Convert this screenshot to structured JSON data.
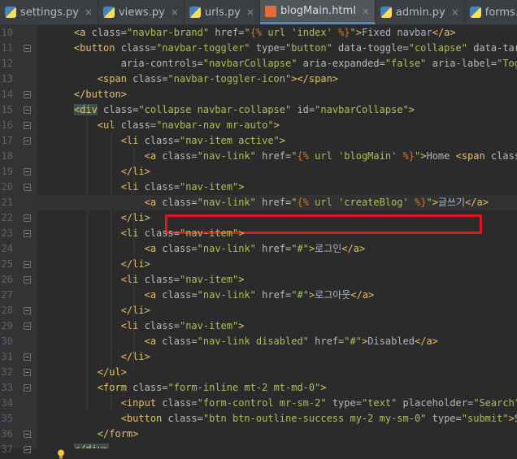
{
  "tabs": [
    {
      "label": "settings.py",
      "kind": "py",
      "active": false
    },
    {
      "label": "views.py",
      "kind": "py",
      "active": false
    },
    {
      "label": "urls.py",
      "kind": "py",
      "active": false
    },
    {
      "label": "blogMain.html",
      "kind": "html",
      "active": true
    },
    {
      "label": "admin.py",
      "kind": "py",
      "active": false
    },
    {
      "label": "forms.py",
      "kind": "py",
      "active": false
    }
  ],
  "close_glyph": "×",
  "lines": [
    {
      "n": "10",
      "segs": [
        [
          "t",
          "    "
        ],
        [
          "tag",
          "<a "
        ],
        [
          "attr",
          "class="
        ],
        [
          "str",
          "\"navbar-brand\""
        ],
        [
          "attr",
          " href="
        ],
        [
          "str",
          "\""
        ],
        [
          "dj",
          "{%"
        ],
        [
          "str",
          " url "
        ],
        [
          "str",
          "'index'"
        ],
        [
          "dj",
          " %}"
        ],
        [
          "str",
          "\""
        ],
        [
          "tag",
          ">"
        ],
        [
          "text",
          "Fixed navbar"
        ],
        [
          "tag",
          "</a>"
        ]
      ]
    },
    {
      "n": "11",
      "segs": [
        [
          "t",
          "    "
        ],
        [
          "tag",
          "<button "
        ],
        [
          "attr",
          "class="
        ],
        [
          "str",
          "\"navbar-toggler\""
        ],
        [
          "attr",
          " type="
        ],
        [
          "str",
          "\"button\""
        ],
        [
          "attr",
          " data-toggle="
        ],
        [
          "str",
          "\"collapse\""
        ],
        [
          "attr",
          " data-target="
        ],
        [
          "str",
          "\"#navbarColl"
        ]
      ]
    },
    {
      "n": "12",
      "segs": [
        [
          "t",
          "            "
        ],
        [
          "attr",
          "aria-controls="
        ],
        [
          "str",
          "\"navbarCollapse\""
        ],
        [
          "attr",
          " aria-expanded="
        ],
        [
          "str",
          "\"false\""
        ],
        [
          "attr",
          " aria-label="
        ],
        [
          "str",
          "\"Toggle navigation\""
        ],
        [
          "tag",
          ">"
        ]
      ]
    },
    {
      "n": "13",
      "segs": [
        [
          "t",
          "        "
        ],
        [
          "tag",
          "<span "
        ],
        [
          "attr",
          "class="
        ],
        [
          "str",
          "\"navbar-toggler-icon\""
        ],
        [
          "tag",
          "></span>"
        ]
      ]
    },
    {
      "n": "14",
      "segs": [
        [
          "t",
          "    "
        ],
        [
          "tag",
          "</button>"
        ]
      ]
    },
    {
      "n": "15",
      "segs": [
        [
          "t",
          "    "
        ],
        [
          "hltag",
          "<div"
        ],
        [
          "attr",
          " class="
        ],
        [
          "str",
          "\"collapse navbar-collapse\""
        ],
        [
          "attr",
          " id="
        ],
        [
          "str",
          "\"navbarCollapse\""
        ],
        [
          "tag",
          ">"
        ]
      ]
    },
    {
      "n": "16",
      "segs": [
        [
          "t",
          "        "
        ],
        [
          "tag",
          "<ul "
        ],
        [
          "attr",
          "class="
        ],
        [
          "str",
          "\"navbar-nav mr-auto\""
        ],
        [
          "tag",
          ">"
        ]
      ]
    },
    {
      "n": "17",
      "segs": [
        [
          "t",
          "            "
        ],
        [
          "tag",
          "<li "
        ],
        [
          "attr",
          "class="
        ],
        [
          "str",
          "\"nav-item active\""
        ],
        [
          "tag",
          ">"
        ]
      ]
    },
    {
      "n": "18",
      "segs": [
        [
          "t",
          "                "
        ],
        [
          "tag",
          "<a "
        ],
        [
          "attr",
          "class="
        ],
        [
          "str",
          "\"nav-link\""
        ],
        [
          "attr",
          " href="
        ],
        [
          "str",
          "\""
        ],
        [
          "dj",
          "{%"
        ],
        [
          "str",
          " url "
        ],
        [
          "str",
          "'blogMain'"
        ],
        [
          "dj",
          " %}"
        ],
        [
          "str",
          "\""
        ],
        [
          "tag",
          ">"
        ],
        [
          "text",
          "Home "
        ],
        [
          "tag",
          "<span "
        ],
        [
          "attr",
          "class="
        ],
        [
          "str",
          "\"sr-only\""
        ],
        [
          "tag",
          ">"
        ],
        [
          "text",
          "(curr"
        ]
      ]
    },
    {
      "n": "19",
      "segs": [
        [
          "t",
          "            "
        ],
        [
          "tag",
          "</li>"
        ]
      ]
    },
    {
      "n": "20",
      "segs": [
        [
          "t",
          "            "
        ],
        [
          "tag",
          "<li "
        ],
        [
          "attr",
          "class="
        ],
        [
          "str",
          "\"nav-item\""
        ],
        [
          "tag",
          ">"
        ]
      ]
    },
    {
      "n": "21",
      "segs": [
        [
          "t",
          "                "
        ],
        [
          "tag",
          "<a "
        ],
        [
          "attr",
          "class="
        ],
        [
          "str",
          "\"nav-link\""
        ],
        [
          "attr",
          " href="
        ],
        [
          "str",
          "\""
        ],
        [
          "dj",
          "{%"
        ],
        [
          "str",
          " url "
        ],
        [
          "str",
          "'createBlog'"
        ],
        [
          "dj",
          " %}"
        ],
        [
          "str",
          "\""
        ],
        [
          "tag",
          ">"
        ],
        [
          "text",
          "글쓰기"
        ],
        [
          "tag",
          "</a>"
        ]
      ],
      "cur": true
    },
    {
      "n": "22",
      "segs": [
        [
          "t",
          "            "
        ],
        [
          "tag",
          "</li>"
        ]
      ]
    },
    {
      "n": "23",
      "segs": [
        [
          "t",
          "            "
        ],
        [
          "tag",
          "<li "
        ],
        [
          "attr",
          "class="
        ],
        [
          "str",
          "\"nav-item\""
        ],
        [
          "tag",
          ">"
        ]
      ]
    },
    {
      "n": "24",
      "segs": [
        [
          "t",
          "                "
        ],
        [
          "tag",
          "<a "
        ],
        [
          "attr",
          "class="
        ],
        [
          "str",
          "\"nav-link\""
        ],
        [
          "attr",
          " href="
        ],
        [
          "str",
          "\"#\""
        ],
        [
          "tag",
          ">"
        ],
        [
          "text",
          "로그인"
        ],
        [
          "tag",
          "</a>"
        ]
      ]
    },
    {
      "n": "25",
      "segs": [
        [
          "t",
          "            "
        ],
        [
          "tag",
          "</li>"
        ]
      ]
    },
    {
      "n": "26",
      "segs": [
        [
          "t",
          "            "
        ],
        [
          "tag",
          "<li "
        ],
        [
          "attr",
          "class="
        ],
        [
          "str",
          "\"nav-item\""
        ],
        [
          "tag",
          ">"
        ]
      ]
    },
    {
      "n": "27",
      "segs": [
        [
          "t",
          "                "
        ],
        [
          "tag",
          "<a "
        ],
        [
          "attr",
          "class="
        ],
        [
          "str",
          "\"nav-link\""
        ],
        [
          "attr",
          " href="
        ],
        [
          "str",
          "\"#\""
        ],
        [
          "tag",
          ">"
        ],
        [
          "text",
          "로그아웃"
        ],
        [
          "tag",
          "</a>"
        ]
      ]
    },
    {
      "n": "28",
      "segs": [
        [
          "t",
          "            "
        ],
        [
          "tag",
          "</li>"
        ]
      ]
    },
    {
      "n": "29",
      "segs": [
        [
          "t",
          "            "
        ],
        [
          "tag",
          "<li "
        ],
        [
          "attr",
          "class="
        ],
        [
          "str",
          "\"nav-item\""
        ],
        [
          "tag",
          ">"
        ]
      ]
    },
    {
      "n": "30",
      "segs": [
        [
          "t",
          "                "
        ],
        [
          "tag",
          "<a "
        ],
        [
          "attr",
          "class="
        ],
        [
          "str",
          "\"nav-link disabled\""
        ],
        [
          "attr",
          " href="
        ],
        [
          "str",
          "\"#\""
        ],
        [
          "tag",
          ">"
        ],
        [
          "text",
          "Disabled"
        ],
        [
          "tag",
          "</a>"
        ]
      ]
    },
    {
      "n": "31",
      "segs": [
        [
          "t",
          "            "
        ],
        [
          "tag",
          "</li>"
        ]
      ]
    },
    {
      "n": "32",
      "segs": [
        [
          "t",
          "        "
        ],
        [
          "tag",
          "</ul>"
        ]
      ]
    },
    {
      "n": "33",
      "segs": [
        [
          "t",
          "        "
        ],
        [
          "tag",
          "<form "
        ],
        [
          "attr",
          "class="
        ],
        [
          "str",
          "\"form-inline mt-2 mt-md-0\""
        ],
        [
          "tag",
          ">"
        ]
      ]
    },
    {
      "n": "34",
      "segs": [
        [
          "t",
          "            "
        ],
        [
          "tag",
          "<input "
        ],
        [
          "attr",
          "class="
        ],
        [
          "str",
          "\"form-control mr-sm-2\""
        ],
        [
          "attr",
          " type="
        ],
        [
          "str",
          "\"text\""
        ],
        [
          "attr",
          " placeholder="
        ],
        [
          "str",
          "\"Search\""
        ],
        [
          "attr",
          " aria-label="
        ],
        [
          "str",
          "\"Sea"
        ]
      ]
    },
    {
      "n": "35",
      "segs": [
        [
          "t",
          "            "
        ],
        [
          "tag",
          "<button "
        ],
        [
          "attr",
          "class="
        ],
        [
          "str",
          "\"btn btn-outline-success my-2 my-sm-0\""
        ],
        [
          "attr",
          " type="
        ],
        [
          "str",
          "\"submit\""
        ],
        [
          "tag",
          ">"
        ],
        [
          "text",
          "Search"
        ],
        [
          "tag",
          "</button>"
        ]
      ]
    },
    {
      "n": "36",
      "segs": [
        [
          "t",
          "        "
        ],
        [
          "tag",
          "</form>"
        ]
      ]
    },
    {
      "n": "37",
      "segs": [
        [
          "t",
          "    "
        ],
        [
          "hltag",
          "</div>"
        ]
      ]
    }
  ],
  "folds": [
    "11",
    "14",
    "15",
    "16",
    "17",
    "19",
    "20",
    "22",
    "23",
    "25",
    "26",
    "28",
    "29",
    "31",
    "32",
    "33",
    "36",
    "37"
  ]
}
